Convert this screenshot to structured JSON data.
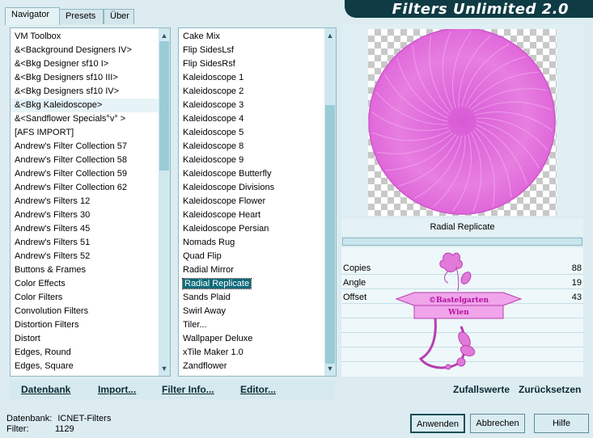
{
  "header": {
    "title": "Filters Unlimited 2.0"
  },
  "tabs": [
    {
      "label": "Navigator",
      "active": true
    },
    {
      "label": "Presets",
      "active": false
    },
    {
      "label": "Über",
      "active": false
    }
  ],
  "categories": [
    "VM Toolbox",
    "&<Background Designers IV>",
    "&<Bkg Designer sf10 I>",
    "&<Bkg Designers sf10 III>",
    "&<Bkg Designers sf10 IV>",
    "&<Bkg Kaleidoscope>",
    "&<Sandflower Specials°v° >",
    "[AFS IMPORT]",
    "Andrew's Filter Collection 57",
    "Andrew's Filter Collection 58",
    "Andrew's Filter Collection 59",
    "Andrew's Filter Collection 62",
    "Andrew's Filters 12",
    "Andrew's Filters 30",
    "Andrew's Filters 45",
    "Andrew's Filters 51",
    "Andrew's Filters 52",
    "Buttons & Frames",
    "Color Effects",
    "Color Filters",
    "Convolution Filters",
    "Distortion Filters",
    "Distort",
    "Edges, Round",
    "Edges, Square"
  ],
  "filters": [
    "Cake Mix",
    "Flip SidesLsf",
    "Flip SidesRsf",
    "Kaleidoscope 1",
    "Kaleidoscope 2",
    "Kaleidoscope 3",
    "Kaleidoscope 4",
    "Kaleidoscope 5",
    "Kaleidoscope 8",
    "Kaleidoscope 9",
    "Kaleidoscope Butterfly",
    "Kaleidoscope Divisions",
    "Kaleidoscope Flower",
    "Kaleidoscope Heart",
    "Kaleidoscope Persian",
    "Nomads Rug",
    "Quad Flip",
    "Radial Mirror",
    "Radial Replicate",
    "Sands Plaid",
    "Swirl Away",
    "Tiler...",
    "Wallpaper Deluxe",
    "xTile Maker 1.0",
    "Zandflower"
  ],
  "selected_category_index": 5,
  "selected_filter_index": 18,
  "selected_filter_name": "Radial Replicate",
  "params": [
    {
      "label": "Copies",
      "value": "88"
    },
    {
      "label": "Angle",
      "value": "19"
    },
    {
      "label": "Offset",
      "value": "43"
    }
  ],
  "watermark": {
    "line1": "©Bastelgarten",
    "line2": "Wien"
  },
  "bottom_buttons": {
    "database": "Datenbank",
    "import": "Import...",
    "filter_info": "Filter Info...",
    "editor": "Editor...",
    "random": "Zufallswerte",
    "reset": "Zurücksetzen"
  },
  "status": {
    "database_label": "Datenbank:",
    "database_value": "ICNET-Filters",
    "filter_label": "Filter:",
    "filter_value": "1129"
  },
  "dialog_buttons": {
    "apply": "Anwenden",
    "cancel": "Abbrechen",
    "help": "Hilfe"
  },
  "colors": {
    "accent": "#0d6a7a",
    "preview_disc": "#e36fdc",
    "banner": "#0f3b44"
  }
}
